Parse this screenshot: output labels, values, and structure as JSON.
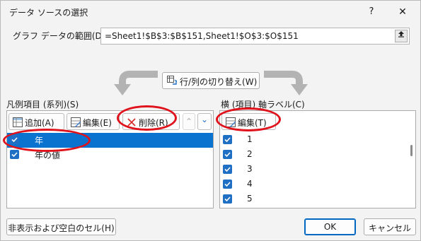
{
  "dialog": {
    "title": "データ ソースの選択",
    "help_glyph": "?",
    "close_glyph": "✕"
  },
  "data_range": {
    "label": "グラフ データの範囲(D):",
    "value": "=Sheet1!$B$3:$B$151,Sheet1!$O$3:$O$151"
  },
  "switch": {
    "label": "行/列の切り替え(W)"
  },
  "legend": {
    "caption": "凡例項目 (系列)(S)",
    "add_label": "追加(A)",
    "edit_label": "編集(E)",
    "remove_label": "削除(R)",
    "up_glyph": "⌃",
    "down_glyph": "⌄",
    "items": [
      {
        "label": "年",
        "checked": true,
        "selected": true
      },
      {
        "label": "年の値",
        "checked": true,
        "selected": false
      }
    ]
  },
  "axis": {
    "caption": "横 (項目) 軸ラベル(C)",
    "edit_label": "編集(T)",
    "items": [
      {
        "label": "1",
        "checked": true
      },
      {
        "label": "2",
        "checked": true
      },
      {
        "label": "3",
        "checked": true
      },
      {
        "label": "4",
        "checked": true
      },
      {
        "label": "5",
        "checked": true
      }
    ]
  },
  "buttons": {
    "hidden_cells": "非表示および空白のセル(H)",
    "ok": "OK",
    "cancel": "キャンセル"
  },
  "colors": {
    "selection": "#0a73d0",
    "checkbox": "#1f6fc4",
    "annotation": "#e0121c",
    "accent": "#0067c0"
  }
}
